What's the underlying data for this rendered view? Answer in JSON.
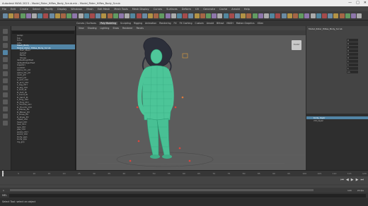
{
  "window": {
    "title": "Autodesk MAYA 2023 – Model_Rider_HiRes_Body_Scrub.mb – Model_Rider_HiRes_Body_Scrub",
    "minimize": "—",
    "maximize": "□",
    "close": "✕"
  },
  "menubar": [
    "File",
    "Edit",
    "Create",
    "Select",
    "Modify",
    "Display",
    "Windows",
    "Mesh",
    "Edit Mesh",
    "Mesh Tools",
    "Mesh Display",
    "Curves",
    "Surfaces",
    "Deform",
    "UV",
    "Generate",
    "Cache",
    "Arnold",
    "Help"
  ],
  "shelf_tabs": [
    "Curves / Surfaces",
    "Poly Modeling",
    "Sculpting",
    "Rigging",
    "Animation",
    "Rendering",
    "FX",
    "FX Caching",
    "Custom",
    "Arnold",
    "Bifrost",
    "MASH",
    "Motion Graphics",
    "XGen"
  ],
  "viewport": {
    "menu": [
      "View",
      "Shading",
      "Lighting",
      "Show",
      "Renderer",
      "Panels"
    ],
    "view_cube_label": "FRONT"
  },
  "outliner": {
    "rows": [
      {
        "label": "persp",
        "sel": false,
        "child": false
      },
      {
        "label": "top",
        "sel": false,
        "child": false
      },
      {
        "label": "front",
        "sel": false,
        "child": false
      },
      {
        "label": "side",
        "sel": false,
        "child": false
      },
      {
        "label": "Mesh_Body",
        "sel": true,
        "child": false
      },
      {
        "label": "Model_Rider_HiRes_Body_Scrub",
        "sel": true,
        "child": false
      },
      {
        "label": "Hair_Main",
        "sel": false,
        "child": true
      },
      {
        "label": "Jacket",
        "sel": false,
        "child": true
      },
      {
        "label": "Pants",
        "sel": false,
        "child": true
      },
      {
        "label": "Shoes",
        "sel": false,
        "child": true
      },
      {
        "label": "defaultLightSet",
        "sel": false,
        "child": false
      },
      {
        "label": "defaultObjectSet",
        "sel": false,
        "child": false
      },
      {
        "label": "hipsCtrl",
        "sel": false,
        "child": false
      },
      {
        "label": "rootCtrl",
        "sel": false,
        "child": false
      },
      {
        "label": "spine_01_jnt",
        "sel": false,
        "child": false
      },
      {
        "label": "spine_02_jnt",
        "sel": false,
        "child": false
      },
      {
        "label": "neck_jnt",
        "sel": false,
        "child": false
      },
      {
        "label": "head_jnt",
        "sel": false,
        "child": false
      },
      {
        "label": "L_arm_Ctrl",
        "sel": false,
        "child": false
      },
      {
        "label": "R_arm_Ctrl",
        "sel": false,
        "child": false
      },
      {
        "label": "L_leg_Ctrl",
        "sel": false,
        "child": false
      },
      {
        "label": "R_leg_Ctrl",
        "sel": false,
        "child": false
      },
      {
        "label": "L_foot_IK",
        "sel": false,
        "child": false
      },
      {
        "label": "R_foot_IK",
        "sel": false,
        "child": false
      },
      {
        "label": "L_hand_IK",
        "sel": false,
        "child": false
      },
      {
        "label": "R_hand_IK",
        "sel": false,
        "child": false
      },
      {
        "label": "L_Fing_Ctrl",
        "sel": false,
        "child": false
      },
      {
        "label": "R_Fing_Ctrl",
        "sel": false,
        "child": false
      },
      {
        "label": "L_Thumb_Ctrl",
        "sel": false,
        "child": false
      },
      {
        "label": "R_Thumb_Ctrl",
        "sel": false,
        "child": false
      },
      {
        "label": "L_Elbow_PV",
        "sel": false,
        "child": false
      },
      {
        "label": "R_Elbow_PV",
        "sel": false,
        "child": false
      },
      {
        "label": "L_Knee_PV",
        "sel": false,
        "child": false
      },
      {
        "label": "R_Knee_PV",
        "sel": false,
        "child": false
      },
      {
        "label": "chest_Ctrl",
        "sel": false,
        "child": false
      },
      {
        "label": "head_Ctrl",
        "sel": false,
        "child": false
      },
      {
        "label": "hair_Ctrl",
        "sel": false,
        "child": false
      },
      {
        "label": "eye_Ctrl",
        "sel": false,
        "child": false
      },
      {
        "label": "jaw_Ctrl",
        "sel": false,
        "child": false
      },
      {
        "label": "pelvis_Ctrl",
        "sel": false,
        "child": false
      },
      {
        "label": "world_Ctrl",
        "sel": false,
        "child": false
      },
      {
        "label": "body_geo",
        "sel": false,
        "child": false
      },
      {
        "label": "body_grp",
        "sel": false,
        "child": false
      },
      {
        "label": "rig_grp",
        "sel": false,
        "child": false
      }
    ]
  },
  "channel_box": {
    "title": "Model_Rider_HiRes_Body_Scrub",
    "values": [
      "0",
      "0",
      "0",
      "0",
      "0",
      "0",
      "1",
      "1",
      "1",
      "on"
    ]
  },
  "layers": {
    "rows": [
      {
        "label": "body_layer",
        "sel": true
      },
      {
        "label": "ctrl_layer",
        "sel": false
      }
    ]
  },
  "timeline": {
    "ticks": [
      "1",
      "5",
      "10",
      "15",
      "20",
      "25",
      "30",
      "35",
      "40",
      "45",
      "50",
      "55",
      "60",
      "65",
      "70",
      "75",
      "80",
      "85",
      "90",
      "95",
      "100",
      "105",
      "110",
      "115",
      "120"
    ],
    "current_frame": "1"
  },
  "range": {
    "start": "1",
    "end": "120",
    "fps": "24 fps"
  },
  "mel_label": "MEL",
  "help_text": "Select Tool: select an object"
}
